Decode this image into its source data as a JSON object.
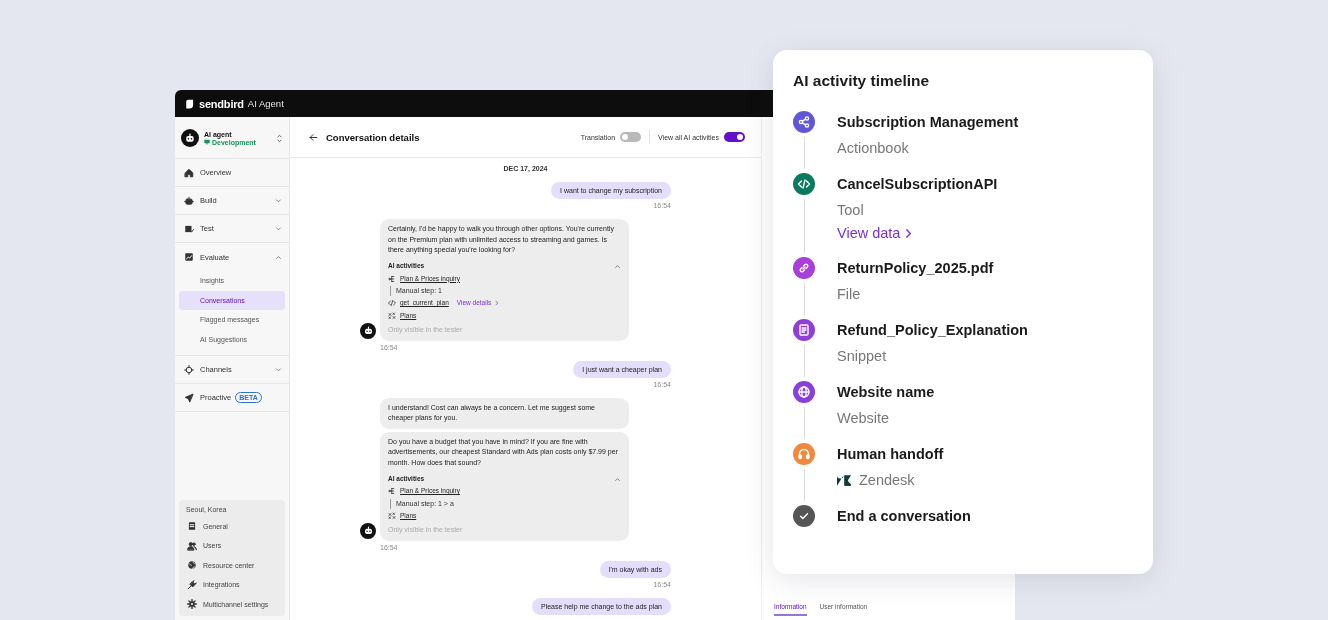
{
  "brand": {
    "logo": "sendbird",
    "product": "AI Agent"
  },
  "sidebar": {
    "agent": {
      "name": "AI agent",
      "environment": "Development"
    },
    "items": [
      {
        "kind": "link",
        "label": "Overview"
      },
      {
        "kind": "group",
        "label": "Build",
        "expanded": false
      },
      {
        "kind": "group",
        "label": "Test",
        "expanded": false
      },
      {
        "kind": "group",
        "label": "Evaluate",
        "expanded": true,
        "children": [
          {
            "label": "Insights",
            "selected": false
          },
          {
            "label": "Conversations",
            "selected": true
          },
          {
            "label": "Flagged messages",
            "selected": false
          },
          {
            "label": "AI Suggestions",
            "selected": false
          }
        ]
      },
      {
        "kind": "group",
        "label": "Channels",
        "expanded": false
      },
      {
        "kind": "link",
        "label": "Proactive",
        "badge": "BETA"
      }
    ],
    "settings": {
      "location": "Seoul, Korea",
      "items": [
        "General",
        "Users",
        "Resource center",
        "Integrations",
        "Multichannel settings"
      ]
    }
  },
  "header": {
    "title": "Conversation details",
    "toggles": [
      {
        "label": "Translation",
        "on": false
      },
      {
        "label": "View all AI activities",
        "on": true
      }
    ]
  },
  "messages": [
    {
      "kind": "date",
      "text": "DEC 17, 2024"
    },
    {
      "kind": "user",
      "text": "I want to change my subscription",
      "time": "16:54"
    },
    {
      "kind": "bot",
      "time": "16:54",
      "bubbles": [
        {
          "text": "Certainly, I'd be happy to walk you through other options. You're currently on the Premium plan with unlimited access to streaming and games. Is there anything special you're looking for?",
          "activities": {
            "title": "AI activities",
            "expanded": true,
            "note": "Only visible in the tester",
            "items": [
              {
                "kind": "actionbook",
                "name": "Plan & Prices inquiry",
                "step": "Manual step: 1"
              },
              {
                "kind": "tool",
                "name": "get_current_plan",
                "link": "View details"
              },
              {
                "kind": "knowledge",
                "name": "Plans"
              }
            ]
          }
        }
      ]
    },
    {
      "kind": "user",
      "text": "I just want a cheaper plan",
      "time": "16:54"
    },
    {
      "kind": "bot",
      "time": "16:54",
      "bubbles": [
        {
          "text": "I understand! Cost can always be a concern. Let me suggest some cheaper plans for you."
        },
        {
          "text": "Do you have a budget that you have in mind? If you are fine with advertisements, our cheapest Standard with Ads plan costs only $7.99 per month. How does that sound?",
          "activities": {
            "title": "AI activities",
            "expanded": true,
            "note": "Only visible in the tester",
            "items": [
              {
                "kind": "actionbook",
                "name": "Plan & Prices inquiry",
                "step": "Manual step: 1 > a"
              },
              {
                "kind": "knowledge",
                "name": "Plans"
              }
            ]
          }
        }
      ]
    },
    {
      "kind": "user",
      "text": "I'm okay with ads",
      "time": "16:54"
    },
    {
      "kind": "user",
      "text": "Please help me change to the ads plan"
    }
  ],
  "info_panel": {
    "tabs": [
      {
        "label": "Information",
        "selected": true
      },
      {
        "label": "User information",
        "selected": false
      }
    ]
  },
  "timeline": {
    "title": "AI activity timeline",
    "items": [
      {
        "kind": "actionbook",
        "color": "#6157d6",
        "title": "Subscription Management",
        "subtitle": "Actionbook"
      },
      {
        "kind": "tool",
        "color": "#0b7a5e",
        "title": "CancelSubscriptionAPI",
        "subtitle": "Tool",
        "link": "View data"
      },
      {
        "kind": "file",
        "color": "#a73fd8",
        "title": "ReturnPolicy_2025.pdf",
        "subtitle": "File"
      },
      {
        "kind": "snippet",
        "color": "#8f3ed6",
        "title": "Refund_Policy_Explanation",
        "subtitle": "Snippet"
      },
      {
        "kind": "website",
        "color": "#8a3fd8",
        "title": "Website name",
        "subtitle": "Website"
      },
      {
        "kind": "handoff",
        "color": "#f0883e",
        "title": "Human handoff",
        "subtitle": "Zendesk"
      },
      {
        "kind": "end",
        "color": "#555555",
        "title": "End a conversation"
      }
    ]
  }
}
